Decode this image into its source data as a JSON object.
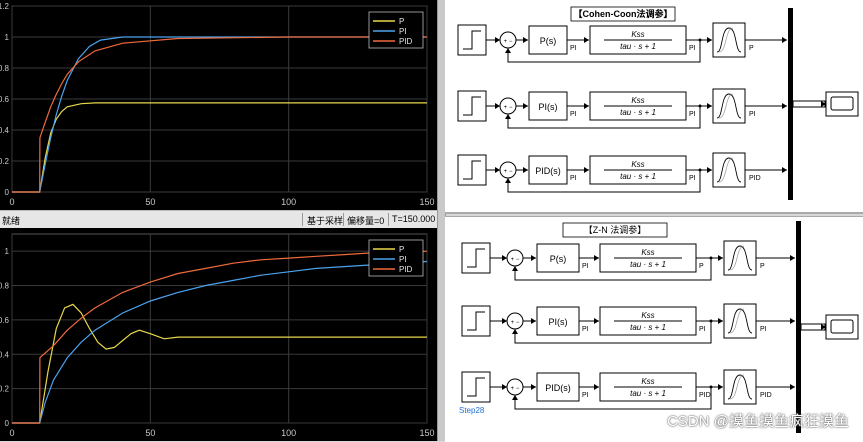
{
  "colors": {
    "p": "#e7d84b",
    "pi": "#4ba3ee",
    "pid": "#ef6b3c",
    "grid": "#3a3a3a",
    "axis_text": "#c8c8c8"
  },
  "status_bar": {
    "left": "就绪",
    "mode": "基于采样",
    "offset": "偏移量=0",
    "time": "T=150.000"
  },
  "chart_data": [
    {
      "type": "line",
      "title": "",
      "xlim": [
        0,
        150
      ],
      "ylim": [
        0,
        1.2
      ],
      "x_ticks": [
        0,
        50,
        100,
        150
      ],
      "y_ticks": [
        0,
        0.2,
        0.4,
        0.6,
        0.8,
        1,
        1.2
      ],
      "x_tick_labels": [
        "0",
        "50",
        "100",
        "150"
      ],
      "y_tick_labels": [
        "0",
        "0.2",
        "0.4",
        "0.6",
        "0.8",
        "1",
        "1.2"
      ],
      "grid": true,
      "legend": "top-right",
      "series": [
        {
          "name": "P",
          "x": [
            0,
            10,
            12,
            14,
            16,
            18,
            20,
            25,
            30,
            40,
            60,
            100,
            150
          ],
          "y": [
            0,
            0,
            0.22,
            0.38,
            0.47,
            0.52,
            0.55,
            0.57,
            0.575,
            0.575,
            0.575,
            0.575,
            0.575
          ]
        },
        {
          "name": "PI",
          "x": [
            0,
            10,
            12,
            14,
            16,
            18,
            20,
            24,
            28,
            32,
            40,
            60,
            100,
            150
          ],
          "y": [
            0,
            0,
            0.18,
            0.35,
            0.5,
            0.62,
            0.72,
            0.86,
            0.94,
            0.98,
            1.0,
            1.0,
            1.0,
            1.0
          ]
        },
        {
          "name": "PID",
          "x": [
            0,
            10,
            10.1,
            12,
            14,
            16,
            18,
            20,
            24,
            30,
            40,
            60,
            100,
            150
          ],
          "y": [
            0,
            0,
            0.35,
            0.45,
            0.55,
            0.63,
            0.7,
            0.76,
            0.84,
            0.91,
            0.96,
            0.99,
            1.0,
            1.0
          ]
        }
      ]
    },
    {
      "type": "line",
      "title": "",
      "xlim": [
        0,
        150
      ],
      "ylim": [
        0,
        1.1
      ],
      "x_ticks": [
        0,
        50,
        100,
        150
      ],
      "y_ticks": [
        0,
        0.2,
        0.4,
        0.6,
        0.8,
        1
      ],
      "x_tick_labels": [
        "0",
        "50",
        "100",
        "150"
      ],
      "y_tick_labels": [
        "0",
        "0.2",
        "0.4",
        "0.6",
        "0.8",
        "1"
      ],
      "grid": true,
      "legend": "top-right",
      "series": [
        {
          "name": "P",
          "x": [
            0,
            10,
            13,
            16,
            19,
            22,
            25,
            28,
            31,
            34,
            37,
            40,
            43,
            46,
            50,
            55,
            60,
            70,
            80,
            100,
            150
          ],
          "y": [
            0,
            0,
            0.3,
            0.55,
            0.67,
            0.69,
            0.64,
            0.55,
            0.47,
            0.43,
            0.44,
            0.48,
            0.52,
            0.54,
            0.52,
            0.49,
            0.5,
            0.5,
            0.5,
            0.5,
            0.5
          ]
        },
        {
          "name": "PI",
          "x": [
            0,
            10,
            12,
            15,
            20,
            25,
            30,
            40,
            50,
            60,
            70,
            80,
            90,
            100,
            110,
            120,
            130,
            140,
            150
          ],
          "y": [
            0,
            0,
            0.12,
            0.25,
            0.38,
            0.47,
            0.54,
            0.64,
            0.71,
            0.76,
            0.8,
            0.83,
            0.86,
            0.88,
            0.9,
            0.91,
            0.92,
            0.93,
            0.94
          ]
        },
        {
          "name": "PID",
          "x": [
            0,
            10,
            10.1,
            15,
            20,
            25,
            30,
            40,
            50,
            60,
            70,
            80,
            90,
            100,
            110,
            120,
            130,
            140,
            150
          ],
          "y": [
            0,
            0,
            0.38,
            0.45,
            0.54,
            0.61,
            0.67,
            0.76,
            0.82,
            0.87,
            0.9,
            0.93,
            0.95,
            0.96,
            0.97,
            0.98,
            0.99,
            0.99,
            1.0
          ]
        }
      ]
    }
  ],
  "diagram_top": {
    "title": "【Cohen-Coon法调参】",
    "rows": [
      {
        "controller": "P(s)",
        "ctrl_out": "PI",
        "plant_num": "Kss",
        "plant_den": "tau · s + 1",
        "plant_out": "PI",
        "delay_out": "P"
      },
      {
        "controller": "PI(s)",
        "ctrl_out": "PI",
        "plant_num": "Kss",
        "plant_den": "tau · s + 1",
        "plant_out": "PI",
        "delay_out": "PI"
      },
      {
        "controller": "PID(s)",
        "ctrl_out": "PI",
        "plant_num": "Kss",
        "plant_den": "tau · s + 1",
        "plant_out": "PI",
        "delay_out": "PID"
      }
    ]
  },
  "diagram_bottom": {
    "title": "【Z-N 法调参】",
    "step_label": "Step28",
    "rows": [
      {
        "controller": "P(s)",
        "ctrl_out": "PI",
        "plant_num": "Kss",
        "plant_den": "tau · s + 1",
        "plant_out": "P",
        "delay_out": "P"
      },
      {
        "controller": "PI(s)",
        "ctrl_out": "PI",
        "plant_num": "Kss",
        "plant_den": "tau · s + 1",
        "plant_out": "PI",
        "delay_out": "PI"
      },
      {
        "controller": "PID(s)",
        "ctrl_out": "PI",
        "plant_num": "Kss",
        "plant_den": "tau · s + 1",
        "plant_out": "PID",
        "delay_out": "PID"
      }
    ]
  },
  "sum_signs": "+ −",
  "watermark": "CSDN @摸鱼摸鱼疯狂摸鱼"
}
